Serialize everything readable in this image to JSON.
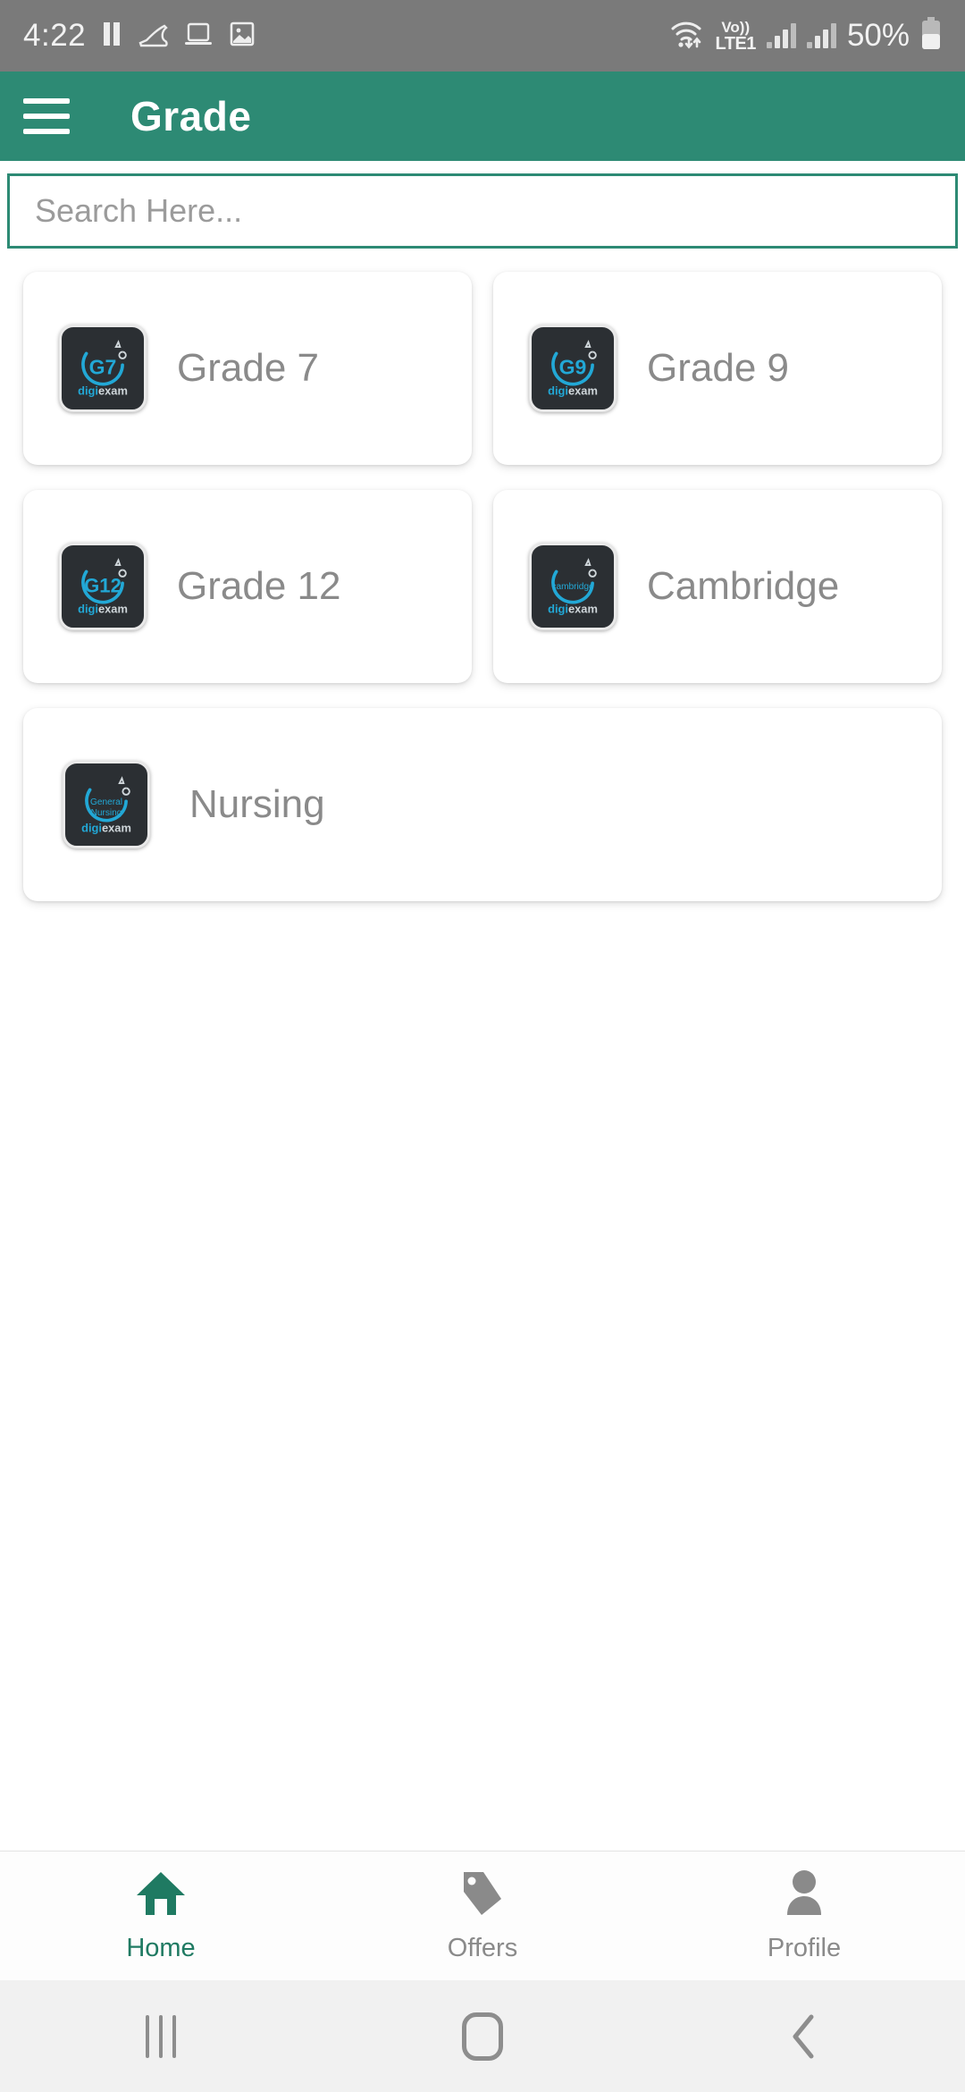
{
  "status_bar": {
    "time": "4:22",
    "battery_percent": "50%",
    "network_label_top": "Vo))",
    "network_label_bottom": "LTE1",
    "left_icons": [
      "pause-icon",
      "shoe-icon",
      "laptop-icon",
      "image-icon"
    ],
    "right_icons": [
      "wifi-icon",
      "signal-bars-icon",
      "signal-bars-icon",
      "battery-icon"
    ],
    "background_color": "#7a7a7a"
  },
  "app_bar": {
    "title": "Grade",
    "menu_icon": "hamburger-menu-icon",
    "background_color": "#2d8a74",
    "title_color": "#ffffff"
  },
  "search": {
    "placeholder": "Search Here...",
    "value": "",
    "border_color": "#2d8a74"
  },
  "grade_cards": [
    {
      "label": "Grade 7",
      "tile_text": "G7",
      "tile_brand": "digiexam",
      "layout": "half"
    },
    {
      "label": "Grade 9",
      "tile_text": "G9",
      "tile_brand": "digiexam",
      "layout": "half"
    },
    {
      "label": "Grade 12",
      "tile_text": "G12",
      "tile_brand": "digiexam",
      "layout": "half"
    },
    {
      "label": "Cambridge",
      "tile_text": "cambridge",
      "tile_brand": "digiexam",
      "layout": "half"
    },
    {
      "label": "Nursing",
      "tile_text": "General Nursing",
      "tile_brand": "digiexam",
      "layout": "full"
    }
  ],
  "bottom_nav": {
    "items": [
      {
        "label": "Home",
        "icon": "home-icon",
        "active": true
      },
      {
        "label": "Offers",
        "icon": "tag-icon",
        "active": false
      },
      {
        "label": "Profile",
        "icon": "person-icon",
        "active": false
      }
    ],
    "active_color": "#1f7a62",
    "inactive_color": "#8a8a8a"
  },
  "system_nav": {
    "recents_icon": "recents-icon",
    "home_icon": "home-square-icon",
    "back_icon": "back-chevron-icon"
  },
  "theme": {
    "accent": "#2d8a74",
    "tile_background": "#2b2f33",
    "tile_accent": "#22a8d6",
    "text_muted": "#8a8a8a"
  }
}
